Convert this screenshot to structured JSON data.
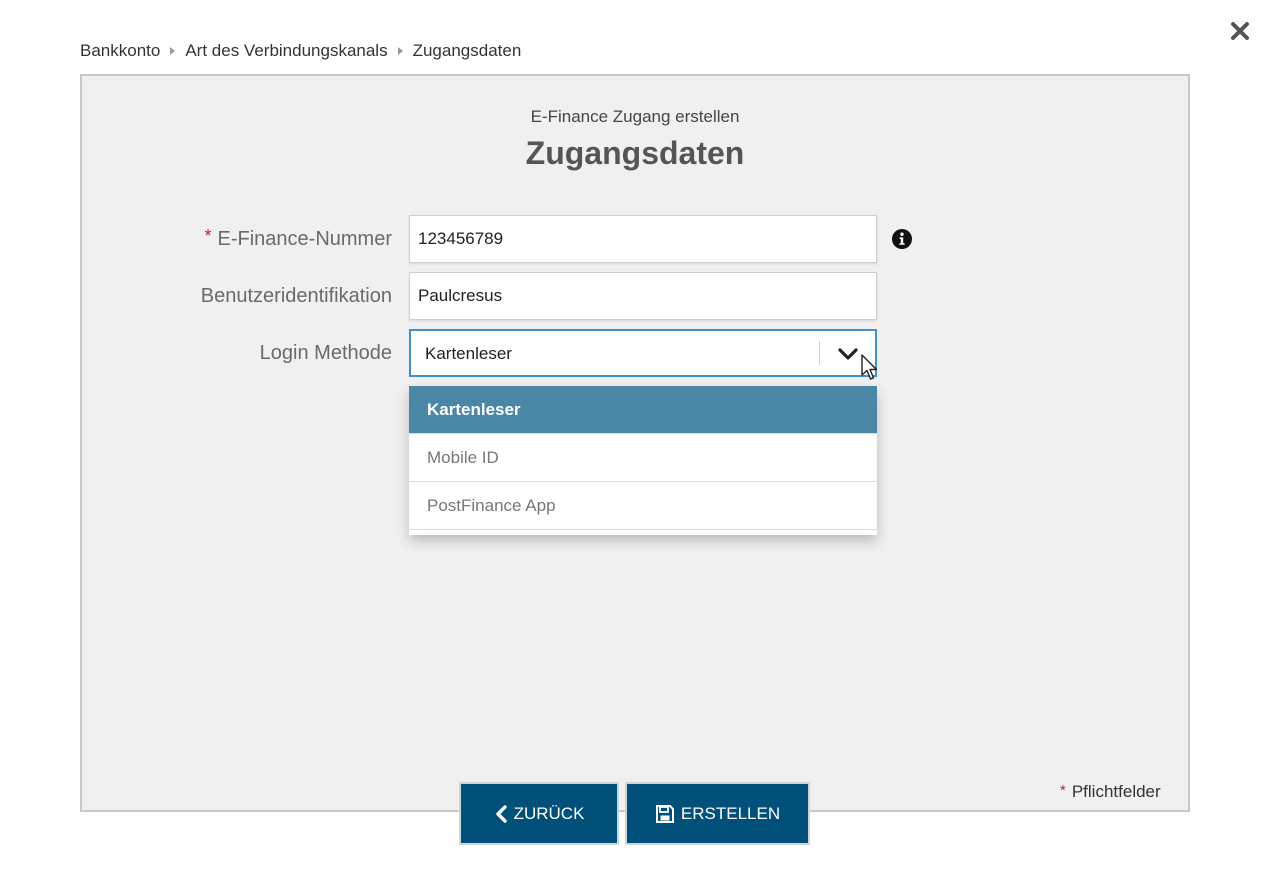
{
  "breadcrumb": {
    "items": [
      {
        "label": "Bankkonto"
      },
      {
        "label": "Art des Verbindungskanals"
      },
      {
        "label": "Zugangsdaten"
      }
    ]
  },
  "header": {
    "subtitle": "E-Finance Zugang erstellen",
    "title": "Zugangsdaten"
  },
  "form": {
    "efinance": {
      "label": "E-Finance-Nummer",
      "value": "123456789",
      "required_mark": "*"
    },
    "userid": {
      "label": "Benutzeridentifikation",
      "value": "Paulcresus"
    },
    "login": {
      "label": "Login Methode",
      "selected": "Kartenleser",
      "options": [
        {
          "label": "Kartenleser"
        },
        {
          "label": "Mobile ID"
        },
        {
          "label": "PostFinance App"
        }
      ]
    }
  },
  "footer": {
    "required_mark": "*",
    "required_note": "Pflichtfelder",
    "back_label": "ZURÜCK",
    "create_label": "ERSTELLEN"
  },
  "icons": {
    "close": "close-icon",
    "info": "info-icon",
    "chevron": "chevron-down-icon",
    "back": "chevron-left-icon",
    "save": "floppy-disk-icon",
    "cursor": "mouse-pointer-icon"
  },
  "colors": {
    "primary_button": "#00507a",
    "selected_option": "#4a87a7",
    "focus_border": "#3f8fd2",
    "required_star": "#c0262d",
    "panel_bg": "#f0f0f0"
  }
}
